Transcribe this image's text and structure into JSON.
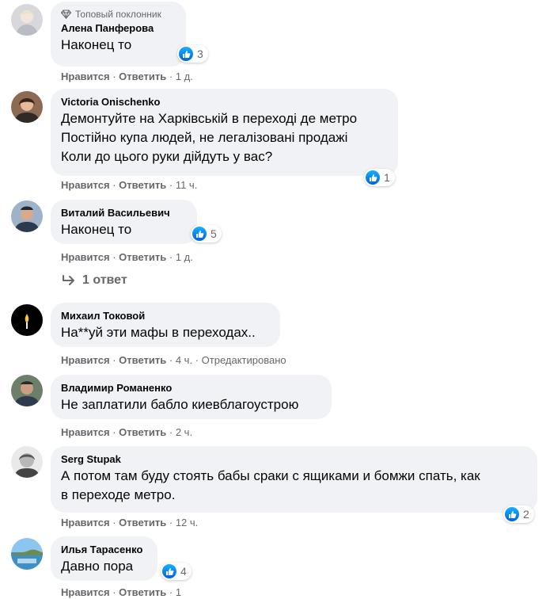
{
  "ui": {
    "like_label": "Нравится",
    "reply_label": "Ответить",
    "separator": "·",
    "like_icon": "thumbs-up-icon",
    "accent": "#1877f2"
  },
  "comments": [
    {
      "badge": "Топовый поклонник",
      "author": "Алена Панферова",
      "text": "Наконец то",
      "reactions": "3",
      "time": "1 д.",
      "edited": ""
    },
    {
      "badge": "",
      "author": "Victoria Onischenko",
      "text": "Демонтуйте на Харківській в переході де метро\nПостійно купа людей, не легалізовані продажі\nКоли до цього руки дійдуть у вас?",
      "reactions": "1",
      "time": "11 ч.",
      "edited": ""
    },
    {
      "badge": "",
      "author": "Виталий Васильевич",
      "text": "Наконец то",
      "reactions": "5",
      "time": "1 д.",
      "edited": ""
    },
    {
      "badge": "",
      "author": "Михаил Токовой",
      "text": "На**уй эти мафы в переходах..",
      "reactions": "",
      "time": "4 ч.",
      "edited": "Отредактировано"
    },
    {
      "badge": "",
      "author": "Владимир Романенко",
      "text": "Не заплатили бабло киевблагоустрою",
      "reactions": "",
      "time": "2 ч.",
      "edited": ""
    },
    {
      "badge": "",
      "author": "Serg Stupak",
      "text": "А потом там буду стоять бабы сраки с ящиками и бомжи спать, как\nв переходе метро.",
      "reactions": "2",
      "time": "12 ч.",
      "edited": ""
    },
    {
      "badge": "",
      "author": "Илья Тарасенко",
      "text": "Давно пора",
      "reactions": "4",
      "time": "1",
      "edited": ""
    }
  ],
  "replies_link": "1 ответ"
}
